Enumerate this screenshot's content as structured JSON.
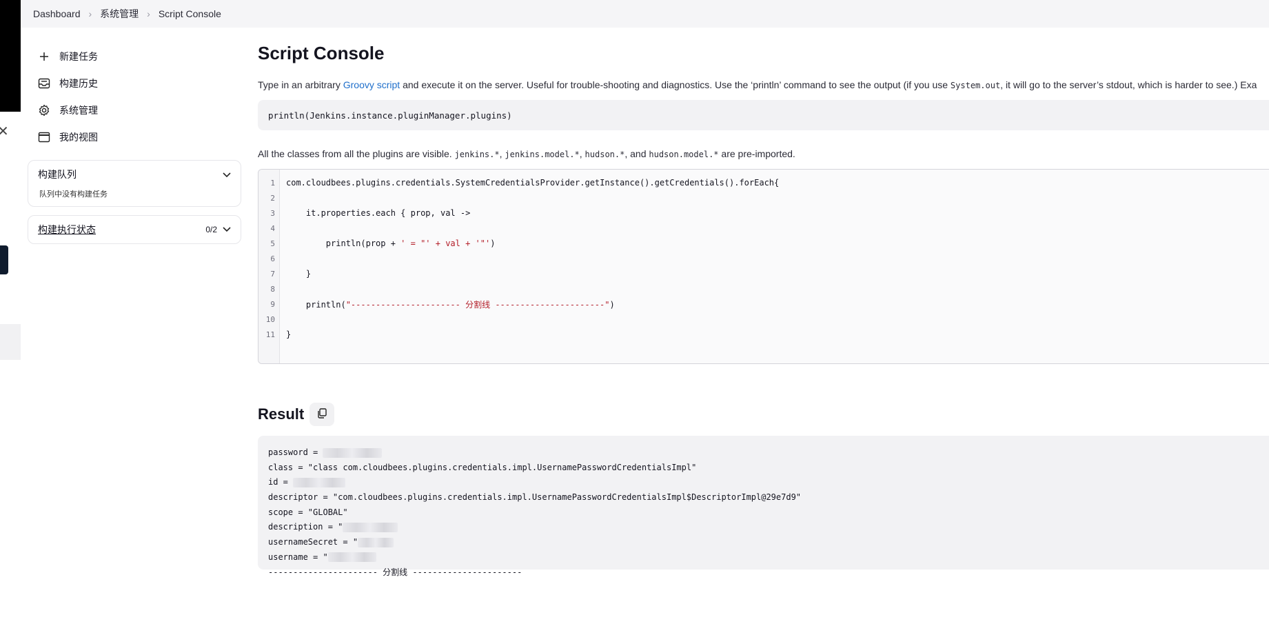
{
  "breadcrumb": [
    {
      "label": "Dashboard"
    },
    {
      "label": "系统管理"
    },
    {
      "label": "Script Console"
    }
  ],
  "sidebar": {
    "tasks": [
      {
        "label": "新建任务",
        "icon": "plus-icon"
      },
      {
        "label": "构建历史",
        "icon": "history-icon"
      },
      {
        "label": "系统管理",
        "icon": "gear-icon"
      },
      {
        "label": "我的视图",
        "icon": "window-icon"
      }
    ],
    "build_queue": {
      "title": "构建队列",
      "empty_text": "队列中没有构建任务"
    },
    "executor_status": {
      "title": "构建执行状态",
      "count": "0/2"
    }
  },
  "main": {
    "title": "Script Console",
    "desc_pre": "Type in an arbitrary ",
    "desc_link": "Groovy script",
    "desc_mid": " and execute it on the server. Useful for trouble-shooting and diagnostics. Use the ‘println’ command to see the output (if you use ",
    "desc_code": "System.out",
    "desc_post": ", it will go to the server’s stdout, which is harder to see.) Exa",
    "example": "println(Jenkins.instance.pluginManager.plugins)",
    "note_pre": "All the classes from all the plugins are visible. ",
    "note_c1": "jenkins.*",
    "note_c2": "jenkins.model.*",
    "note_c3": "hudson.*",
    "note_and": ", and ",
    "note_c4": "hudson.model.*",
    "note_post": " are pre-imported.",
    "code_lines": [
      {
        "n": "1",
        "a": "com.cloudbees.plugins.credentials.SystemCredentialsProvider.getInstance().getCredentials().forEach{",
        "s": "",
        "b": ""
      },
      {
        "n": "2",
        "a": "",
        "s": "",
        "b": ""
      },
      {
        "n": "3",
        "a": "    it.properties.each { prop, val ->",
        "s": "",
        "b": ""
      },
      {
        "n": "4",
        "a": "",
        "s": "",
        "b": ""
      },
      {
        "n": "5",
        "a": "        println(prop + ",
        "s": "' = \"' + val + '\"'",
        "b": ")"
      },
      {
        "n": "6",
        "a": "",
        "s": "",
        "b": ""
      },
      {
        "n": "7",
        "a": "    }",
        "s": "",
        "b": ""
      },
      {
        "n": "8",
        "a": "",
        "s": "",
        "b": ""
      },
      {
        "n": "9",
        "a": "    println(",
        "s": "\"---------------------- 分割线 ----------------------\"",
        "b": ")"
      },
      {
        "n": "10",
        "a": "",
        "s": "",
        "b": ""
      },
      {
        "n": "11",
        "a": "}",
        "s": "",
        "b": ""
      }
    ],
    "result_title": "Result",
    "result_lines": [
      {
        "t": "password = ",
        "redacted": 1
      },
      {
        "t": "class = \"class com.cloudbees.plugins.credentials.impl.UsernamePasswordCredentialsImpl\"",
        "redacted": 0
      },
      {
        "t": "id = ",
        "redacted": 1
      },
      {
        "t": "descriptor = \"com.cloudbees.plugins.credentials.impl.UsernamePasswordCredentialsImpl$DescriptorImpl@29e7d9\"",
        "redacted": 0
      },
      {
        "t": "scope = \"GLOBAL\"",
        "redacted": 0
      },
      {
        "t": "description = \"",
        "redacted": 1
      },
      {
        "t": "usernameSecret = \"",
        "redacted": 1
      },
      {
        "t": "username = \"",
        "redacted": 1
      },
      {
        "t": "---------------------- 分割线 ----------------------",
        "redacted": 0
      }
    ]
  },
  "colors": {
    "link": "#1f6fcb",
    "string": "#b31d28"
  }
}
